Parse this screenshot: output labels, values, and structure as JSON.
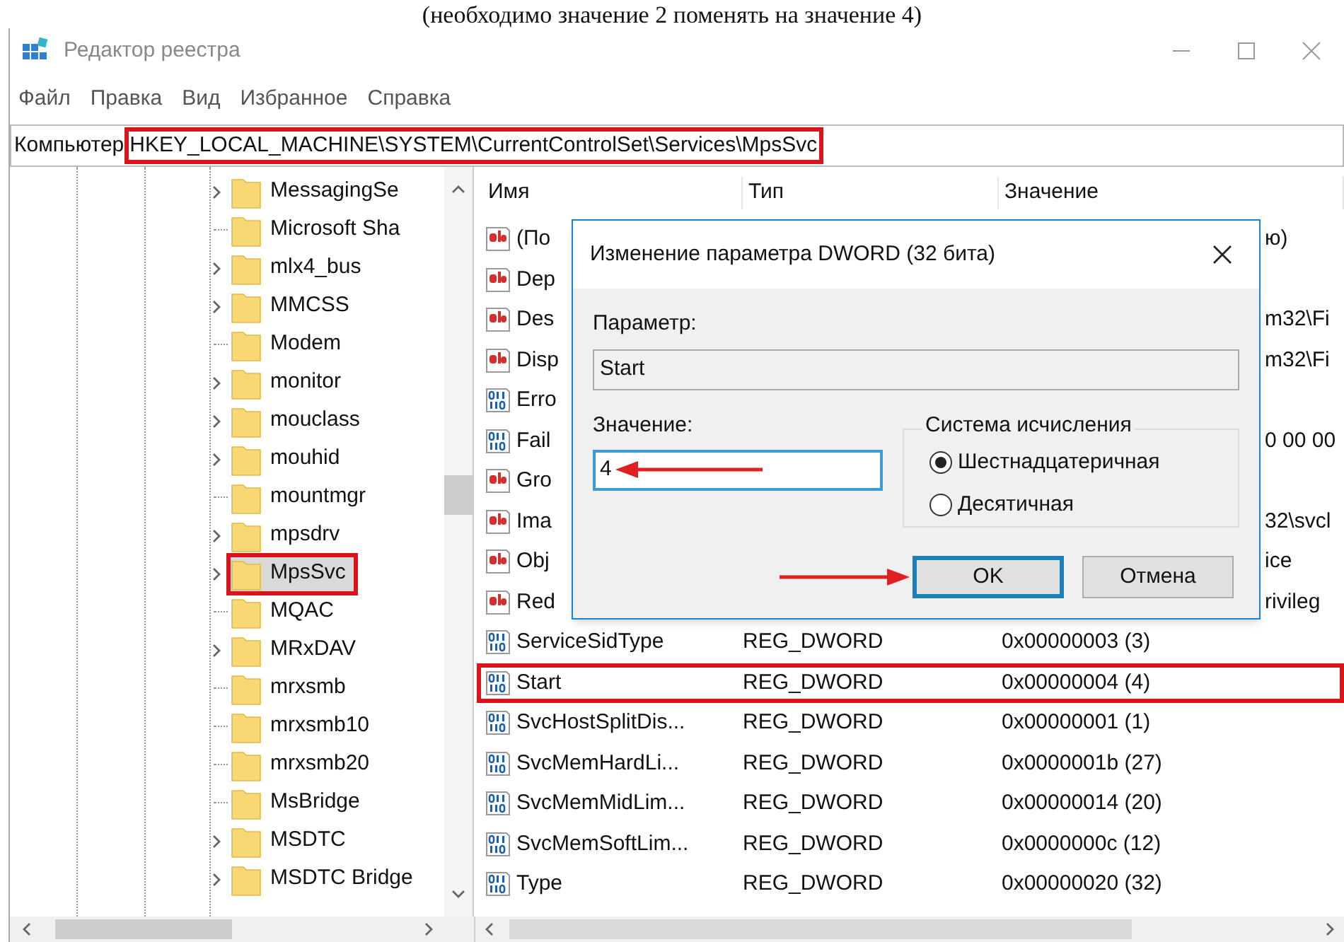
{
  "caption": "(необходимо значение 2 поменять на значение 4)",
  "window": {
    "title": "Редактор реестра"
  },
  "menu": [
    "Файл",
    "Правка",
    "Вид",
    "Избранное",
    "Справка"
  ],
  "address": {
    "root": "Компьютер",
    "path": "HKEY_LOCAL_MACHINE\\SYSTEM\\CurrentControlSet\\Services\\MpsSvc",
    "marked": true
  },
  "tree": [
    {
      "label": "MessagingSe",
      "expandable": true,
      "selected": false,
      "marked": false
    },
    {
      "label": "Microsoft Sha",
      "expandable": false,
      "selected": false,
      "marked": false
    },
    {
      "label": "mlx4_bus",
      "expandable": true,
      "selected": false,
      "marked": false
    },
    {
      "label": "MMCSS",
      "expandable": true,
      "selected": false,
      "marked": false
    },
    {
      "label": "Modem",
      "expandable": false,
      "selected": false,
      "marked": false
    },
    {
      "label": "monitor",
      "expandable": true,
      "selected": false,
      "marked": false
    },
    {
      "label": "mouclass",
      "expandable": true,
      "selected": false,
      "marked": false
    },
    {
      "label": "mouhid",
      "expandable": true,
      "selected": false,
      "marked": false
    },
    {
      "label": "mountmgr",
      "expandable": false,
      "selected": false,
      "marked": false
    },
    {
      "label": "mpsdrv",
      "expandable": true,
      "selected": false,
      "marked": false
    },
    {
      "label": "MpsSvc",
      "expandable": true,
      "selected": true,
      "marked": true
    },
    {
      "label": "MQAC",
      "expandable": false,
      "selected": false,
      "marked": false
    },
    {
      "label": "MRxDAV",
      "expandable": true,
      "selected": false,
      "marked": false
    },
    {
      "label": "mrxsmb",
      "expandable": false,
      "selected": false,
      "marked": false
    },
    {
      "label": "mrxsmb10",
      "expandable": false,
      "selected": false,
      "marked": false
    },
    {
      "label": "mrxsmb20",
      "expandable": false,
      "selected": false,
      "marked": false
    },
    {
      "label": "MsBridge",
      "expandable": false,
      "selected": false,
      "marked": false
    },
    {
      "label": "MSDTC",
      "expandable": true,
      "selected": false,
      "marked": false
    },
    {
      "label": "MSDTC Bridge",
      "expandable": true,
      "selected": false,
      "marked": false
    }
  ],
  "list": {
    "columns": [
      "Имя",
      "Тип",
      "Значение"
    ],
    "rows": [
      {
        "kind": "string",
        "name": "(По",
        "value": "ю)",
        "marked": false
      },
      {
        "kind": "string",
        "name": "Dep",
        "marked": false
      },
      {
        "kind": "string",
        "name": "Des",
        "value": "m32\\Fi",
        "marked": false
      },
      {
        "kind": "string",
        "name": "Disp",
        "value": "m32\\Fi",
        "marked": false
      },
      {
        "kind": "binary",
        "name": "Erro",
        "marked": false
      },
      {
        "kind": "binary",
        "name": "Fail",
        "value": "0 00 00",
        "marked": false
      },
      {
        "kind": "string",
        "name": "Gro",
        "marked": false
      },
      {
        "kind": "string",
        "name": "Ima",
        "value": "32\\svcl",
        "marked": false
      },
      {
        "kind": "string",
        "name": "Obj",
        "value": "ice",
        "marked": false
      },
      {
        "kind": "string",
        "name": "Red",
        "value": "rivileg",
        "marked": false
      },
      {
        "kind": "binary",
        "name": "ServiceSidType",
        "type": "REG_DWORD",
        "value": "0x00000003 (3)",
        "marked": false
      },
      {
        "kind": "binary",
        "name": "Start",
        "type": "REG_DWORD",
        "value": "0x00000004 (4)",
        "marked": true
      },
      {
        "kind": "binary",
        "name": "SvcHostSplitDis...",
        "type": "REG_DWORD",
        "value": "0x00000001 (1)",
        "marked": false
      },
      {
        "kind": "binary",
        "name": "SvcMemHardLi...",
        "type": "REG_DWORD",
        "value": "0x0000001b (27)",
        "marked": false
      },
      {
        "kind": "binary",
        "name": "SvcMemMidLim...",
        "type": "REG_DWORD",
        "value": "0x00000014 (20)",
        "marked": false
      },
      {
        "kind": "binary",
        "name": "SvcMemSoftLim...",
        "type": "REG_DWORD",
        "value": "0x0000000c (12)",
        "marked": false
      },
      {
        "kind": "binary",
        "name": "Type",
        "type": "REG_DWORD",
        "value": "0x00000020 (32)",
        "marked": false
      }
    ]
  },
  "dialog": {
    "title": "Изменение параметра DWORD (32 бита)",
    "name_label": "Параметр:",
    "name_value": "Start",
    "value_label": "Значение:",
    "value": "4",
    "base_group": "Система исчисления",
    "bases": [
      {
        "label": "Шестнадцатеричная",
        "selected": true
      },
      {
        "label": "Десятичная",
        "selected": false
      }
    ],
    "buttons": [
      {
        "label": "OK",
        "default": true
      },
      {
        "label": "Отмена",
        "default": false
      }
    ]
  }
}
